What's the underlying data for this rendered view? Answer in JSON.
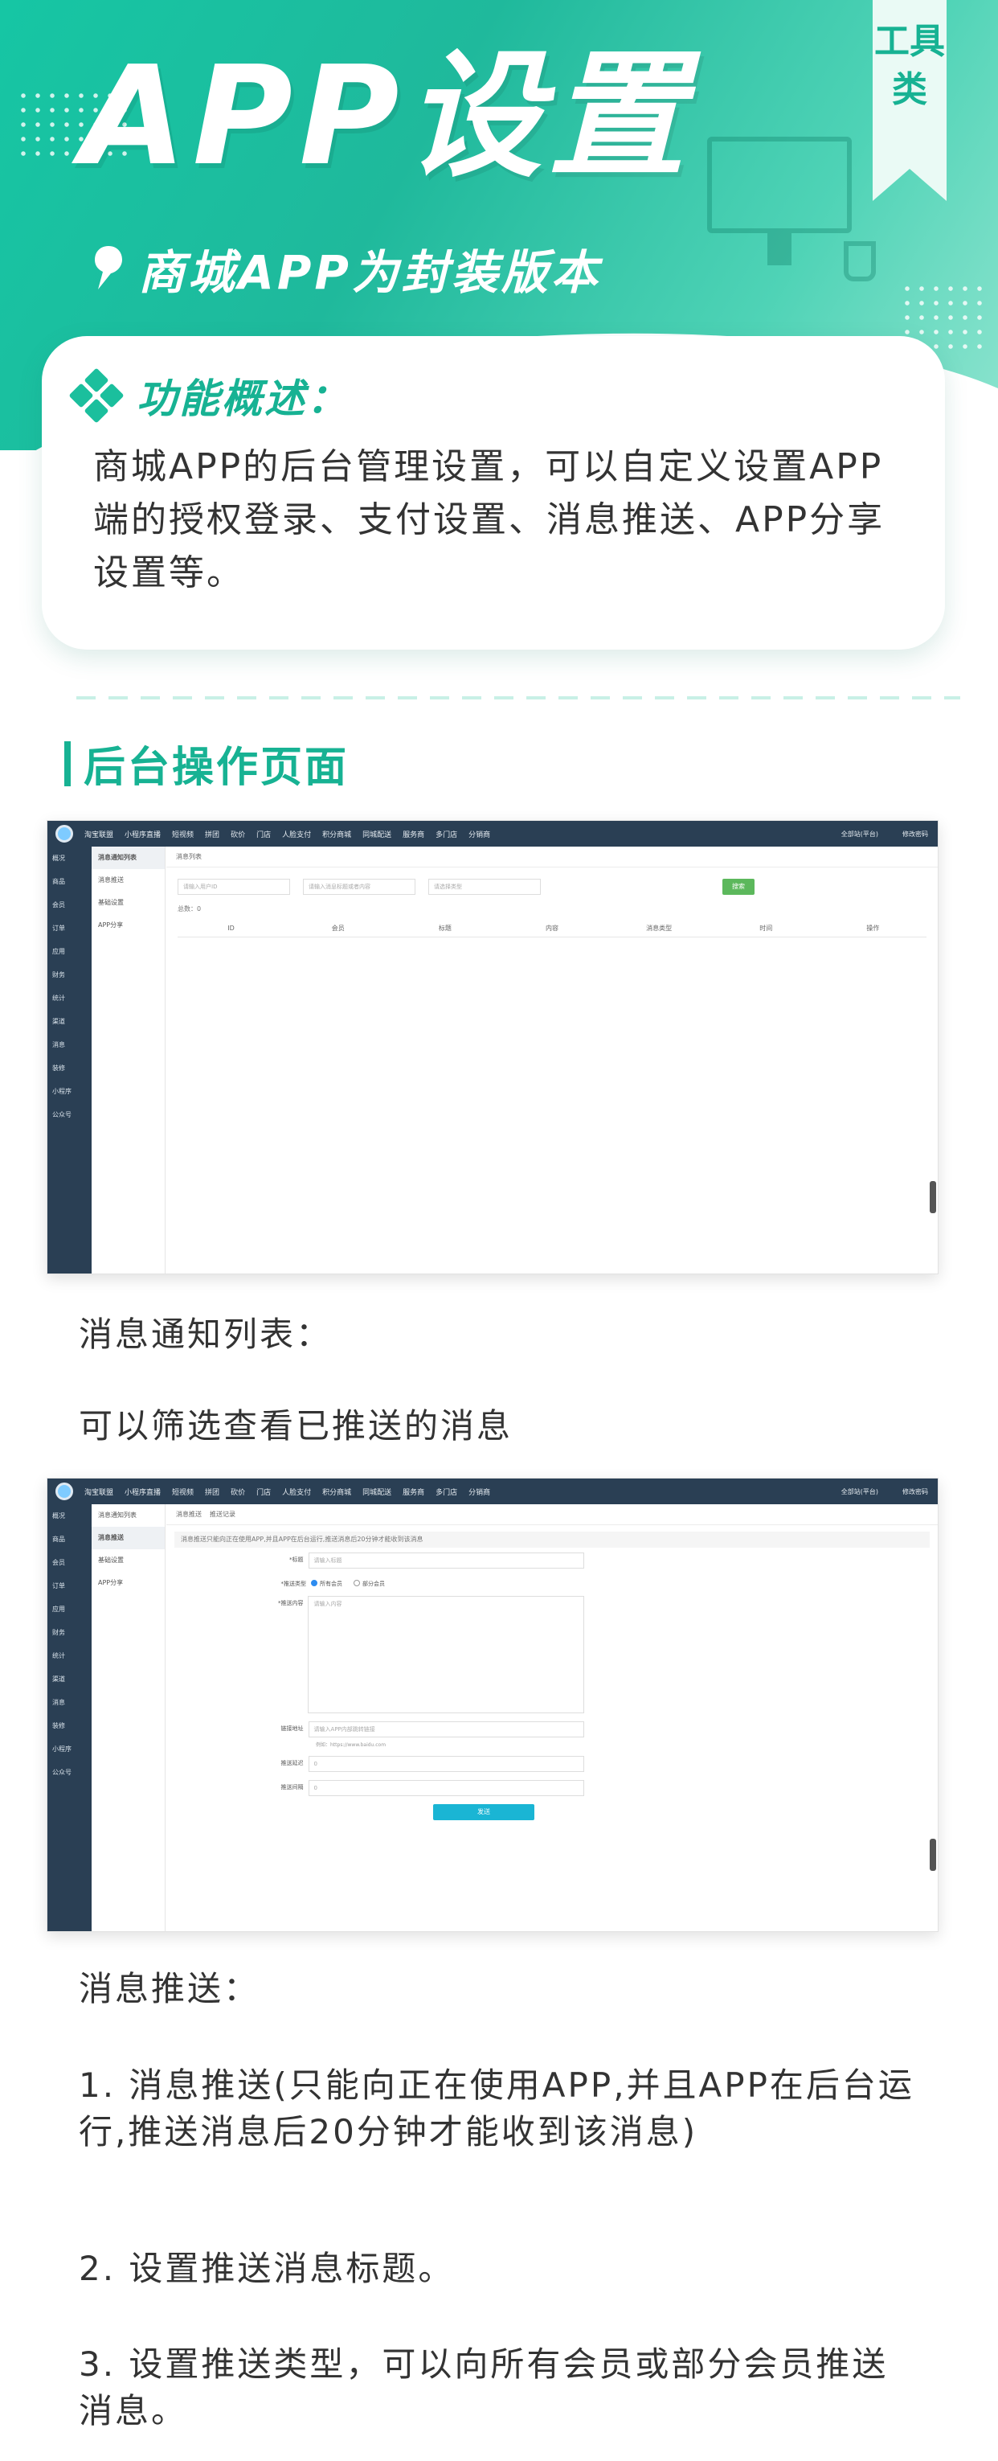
{
  "hero": {
    "title": "APP设置",
    "subtitle": "商城APP为封装版本",
    "tag": "工具类"
  },
  "overview": {
    "heading": "功能概述：",
    "body": "商城APP的后台管理设置，可以自定义设置APP端的授权登录、支付设置、消息推送、APP分享设置等。"
  },
  "section": {
    "title": "后台操作页面"
  },
  "admin": {
    "top_nav": [
      "淘宝联盟",
      "小程序直播",
      "短视频",
      "拼团",
      "砍价",
      "门店",
      "人脸支付",
      "积分商城",
      "同城配送",
      "服务商",
      "多门店",
      "分销商"
    ],
    "top_right": [
      "全部站(平台)",
      "修改密码"
    ],
    "side_menu": [
      "概况",
      "商品",
      "会员",
      "订单",
      "应用",
      "财务",
      "统计",
      "渠道",
      "消息",
      "装修",
      "小程序",
      "公众号"
    ],
    "sub_menu_1": [
      "消息通知列表",
      "消息推送",
      "基础设置",
      "APP分享"
    ],
    "sub_menu_2": [
      "消息通知列表",
      "消息推送",
      "基础设置",
      "APP分享"
    ]
  },
  "shot1": {
    "crumb": [
      "消息列表"
    ],
    "filters": [
      "请输入用户ID",
      "请输入消息标题或者内容",
      "请选择类型"
    ],
    "search_button": "搜索",
    "total": "总数：0",
    "columns": [
      "ID",
      "会员",
      "标题",
      "内容",
      "消息类型",
      "时间",
      "操作"
    ]
  },
  "shot2": {
    "crumb": [
      "消息推送",
      "推送记录"
    ],
    "notice": "消息推送只能向正在使用APP,并且APP在后台运行,推送消息后20分钟才能收到该消息",
    "fields": {
      "title_label": "*标题",
      "title_placeholder": "请输入标题",
      "type_label": "*推送类型",
      "type_all": "所有会员",
      "type_part": "部分会员",
      "content_label": "*推送内容",
      "content_placeholder": "请输入内容",
      "link_label": "链接地址",
      "link_placeholder": "请输入APP内部跳转链接",
      "link_hint": "例如：https://www.baidu.com",
      "delay_label": "推送延迟",
      "delay_value": "0",
      "count_label": "推送间隔",
      "count_value": "0"
    },
    "send_button": "发送"
  },
  "texts": {
    "t1": "消息通知列表：",
    "t2": "可以筛选查看已推送的消息",
    "t3": "消息推送：",
    "t4": "1. 消息推送(只能向正在使用APP,并且APP在后台运行,推送消息后20分钟才能收到该消息)",
    "t5": "2. 设置推送消息标题。",
    "t6": "3. 设置推送类型，可以向所有会员或部分会员推送消息。"
  },
  "colors": {
    "accent": "#17b293",
    "hero_start": "#16c6a4",
    "admin_dark": "#2a3f54"
  }
}
